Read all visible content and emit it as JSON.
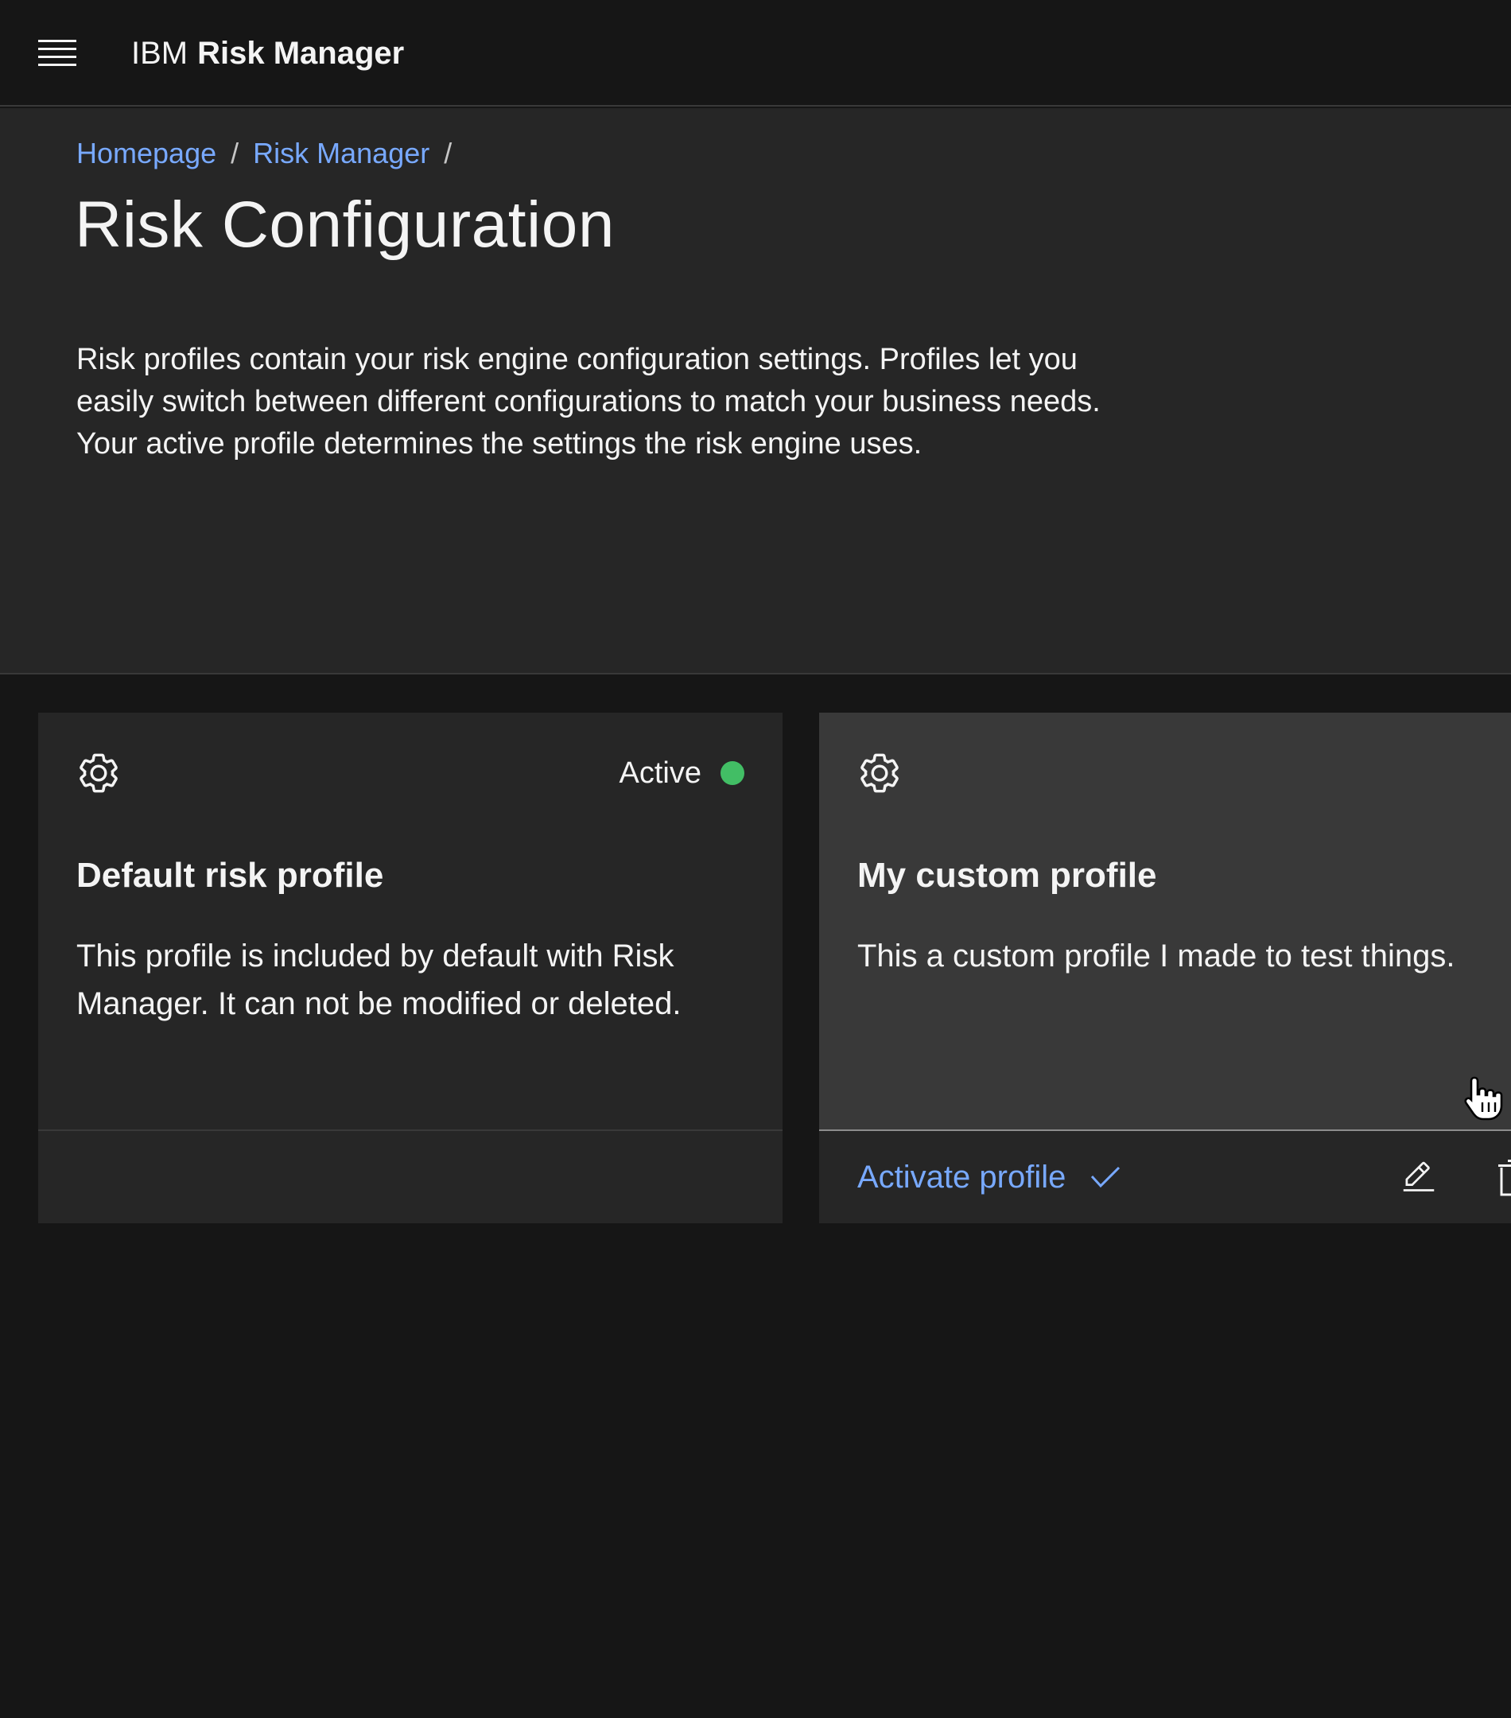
{
  "header": {
    "brand_prefix": "IBM",
    "brand_name": "Risk Manager",
    "menu_icon": "hamburger-menu-icon"
  },
  "breadcrumb": {
    "items": [
      {
        "label": "Homepage"
      },
      {
        "label": "Risk Manager"
      }
    ],
    "separator": "/"
  },
  "page": {
    "title": "Risk Configuration",
    "description": "Risk profiles contain your risk engine configuration settings. Profiles let you easily switch between different configurations to match your business needs. Your active profile determines the settings the risk engine uses."
  },
  "cards": [
    {
      "icon": "gear-icon",
      "status": "Active",
      "status_color": "#42be65",
      "title": "Default risk profile",
      "description": "This profile is included by default with Risk Manager. It can not be modified or deleted."
    },
    {
      "icon": "gear-icon",
      "title": "My custom profile",
      "description": "This a custom profile I made to test things.",
      "activate_label": "Activate profile",
      "edit_icon": "edit-pencil-icon",
      "delete_icon": "trash-icon"
    }
  ],
  "colors": {
    "background": "#161616",
    "surface": "#262626",
    "surface_hover": "#393939",
    "link": "#78a9ff",
    "text": "#f4f4f4",
    "success": "#42be65"
  }
}
